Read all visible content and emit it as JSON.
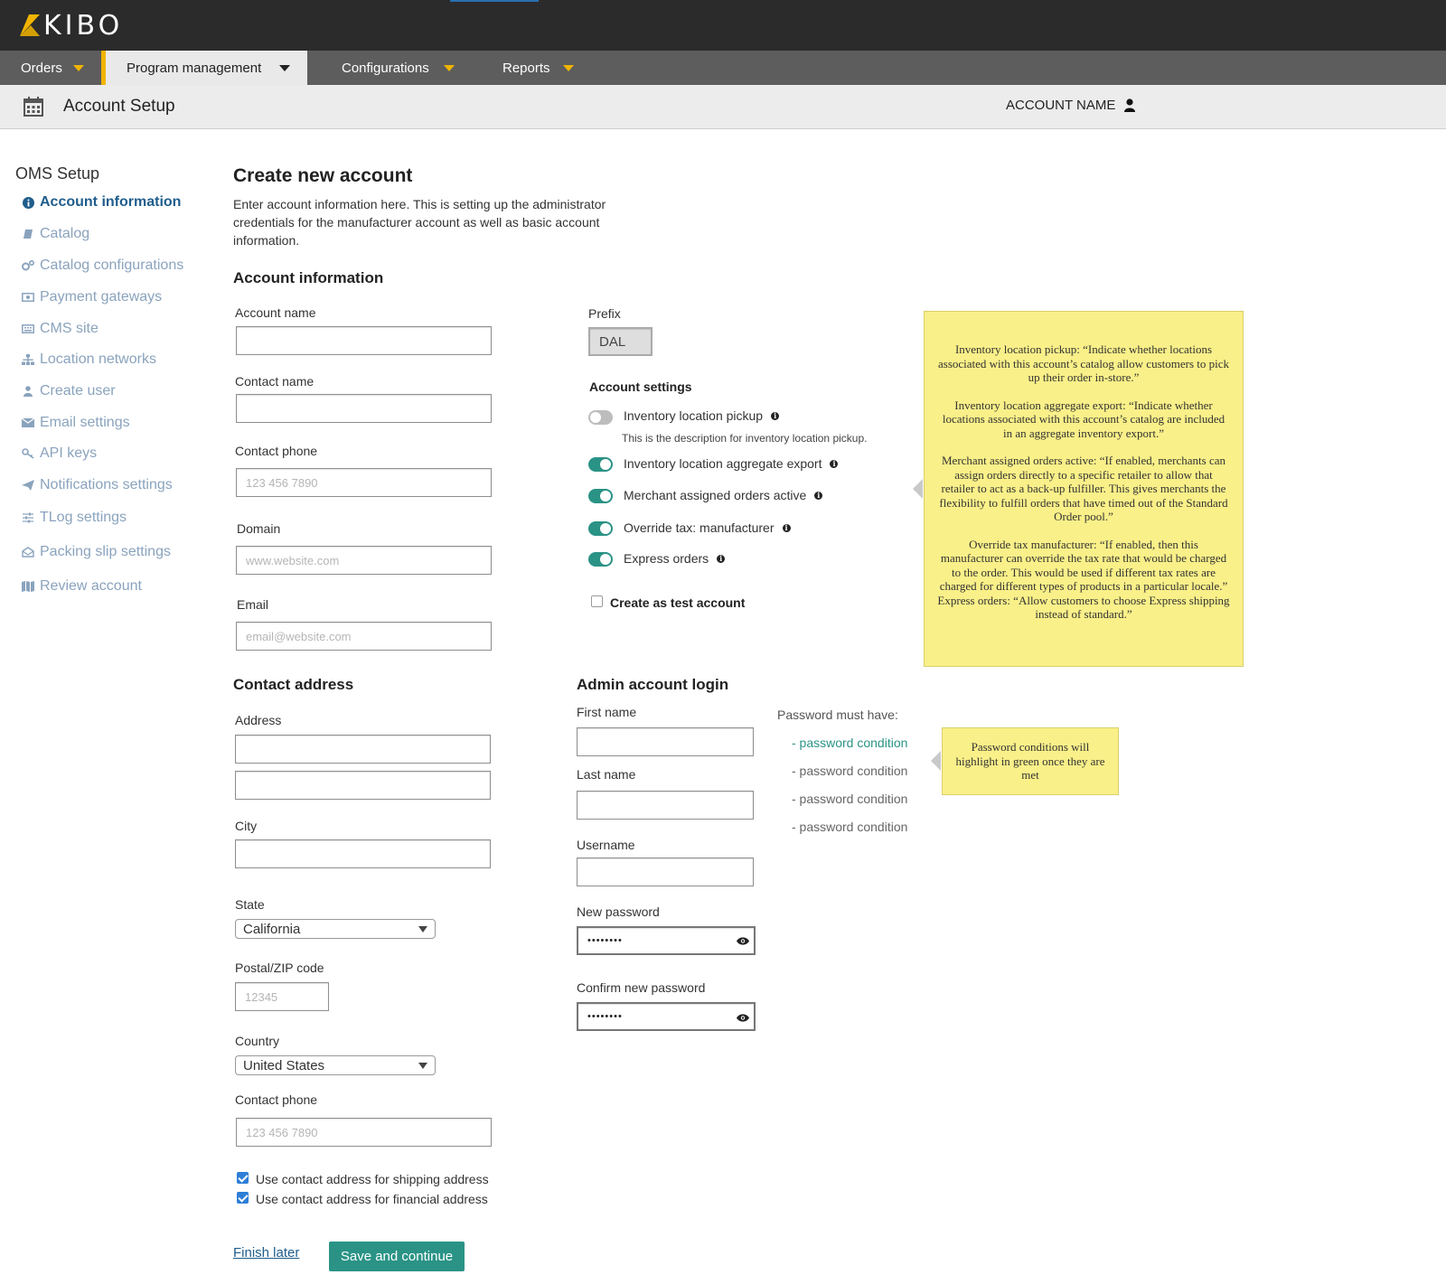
{
  "brand": {
    "logo_text": "KIBO"
  },
  "nav": {
    "items": [
      {
        "label": "Orders"
      },
      {
        "label": "Program management"
      },
      {
        "label": "Configurations"
      },
      {
        "label": "Reports"
      }
    ]
  },
  "page_header": {
    "title": "Account Setup",
    "account_name": "ACCOUNT NAME"
  },
  "sidebar": {
    "title": "OMS Setup",
    "items": [
      {
        "label": "Account information",
        "icon": "info-icon",
        "active": true
      },
      {
        "label": "Catalog",
        "icon": "book-icon"
      },
      {
        "label": "Catalog configurations",
        "icon": "gears-icon"
      },
      {
        "label": "Payment gateways",
        "icon": "money-icon"
      },
      {
        "label": "CMS site",
        "icon": "keyboard-icon"
      },
      {
        "label": "Location networks",
        "icon": "sitemap-icon"
      },
      {
        "label": "Create user",
        "icon": "user-icon"
      },
      {
        "label": "Email settings",
        "icon": "envelope-icon"
      },
      {
        "label": "API keys",
        "icon": "key-icon"
      },
      {
        "label": "Notifications settings",
        "icon": "paper-plane-icon"
      },
      {
        "label": "TLog settings",
        "icon": "sliders-icon"
      },
      {
        "label": "Packing slip settings",
        "icon": "open-envelope-icon"
      },
      {
        "label": "Review account",
        "icon": "map-icon"
      }
    ]
  },
  "main": {
    "title": "Create new account",
    "description": "Enter account information here. This is setting up the administrator credentials for the manufacturer account as well as basic account information.",
    "account_info": {
      "heading": "Account information",
      "account_name_label": "Account name",
      "contact_name_label": "Contact name",
      "contact_phone_label": "Contact phone",
      "contact_phone_placeholder": "123 456 7890",
      "domain_label": "Domain",
      "domain_placeholder": "www.website.com",
      "email_label": "Email",
      "email_placeholder": "email@website.com",
      "prefix_label": "Prefix",
      "prefix_value": "DAL"
    },
    "account_settings": {
      "heading": "Account settings",
      "toggles": [
        {
          "label": "Inventory location pickup",
          "on": false,
          "description": "This is the description for inventory location pickup."
        },
        {
          "label": "Inventory location aggregate export",
          "on": true
        },
        {
          "label": "Merchant assigned orders active",
          "on": true
        },
        {
          "label": "Override tax: manufacturer",
          "on": true
        },
        {
          "label": "Express orders",
          "on": true
        }
      ],
      "test_account_label": "Create as test account"
    },
    "settings_note": [
      "Inventory location pickup: “Indicate whether locations associated with this account’s catalog allow customers to pick up their order in-store.”",
      "Inventory location aggregate export: “Indicate whether locations associated with this account’s catalog are included in an aggregate inventory export.”",
      "Merchant assigned orders active: “If enabled, merchants can assign orders directly to a specific retailer to allow that retailer to act as a back-up fulfiller. This gives merchants the flexibility to fulfill orders that have timed out of the Standard Order pool.”",
      "Override tax manufacturer: “If enabled, then this manufacturer can override the tax rate that would be charged to the order. This would be used if different tax rates are charged for different types of products in a particular locale.”",
      "Express orders: “Allow customers to choose Express shipping instead of standard.”"
    ],
    "contact_address": {
      "heading": "Contact address",
      "address_label": "Address",
      "city_label": "City",
      "state_label": "State",
      "state_value": "California",
      "postal_label": "Postal/ZIP code",
      "postal_placeholder": "12345",
      "country_label": "Country",
      "country_value": "United States",
      "phone_label": "Contact phone",
      "phone_placeholder": "123 456 7890",
      "shipping_checkbox": "Use contact address for shipping address",
      "financial_checkbox": "Use contact address for financial address"
    },
    "admin_login": {
      "heading": "Admin account login",
      "first_name_label": "First name",
      "last_name_label": "Last name",
      "username_label": "Username",
      "new_password_label": "New password",
      "new_password_value": "••••••••",
      "confirm_password_label": "Confirm new password",
      "confirm_password_value": "••••••••",
      "password_heading": "Password must have:",
      "conditions": [
        {
          "text": "- password condition",
          "met": true
        },
        {
          "text": "- password condition",
          "met": false
        },
        {
          "text": "- password condition",
          "met": false
        },
        {
          "text": "- password condition",
          "met": false
        }
      ],
      "password_note": "Password conditions will highlight in green once they are met"
    },
    "actions": {
      "finish_later": "Finish later",
      "save_continue": "Save and continue"
    }
  },
  "colors": {
    "primary": "#2a9386",
    "accent": "#f2b400",
    "link": "#1f5d8c",
    "note": "#faf089",
    "topbar": "#2b2b2b",
    "navbar": "#5d5d5d"
  }
}
